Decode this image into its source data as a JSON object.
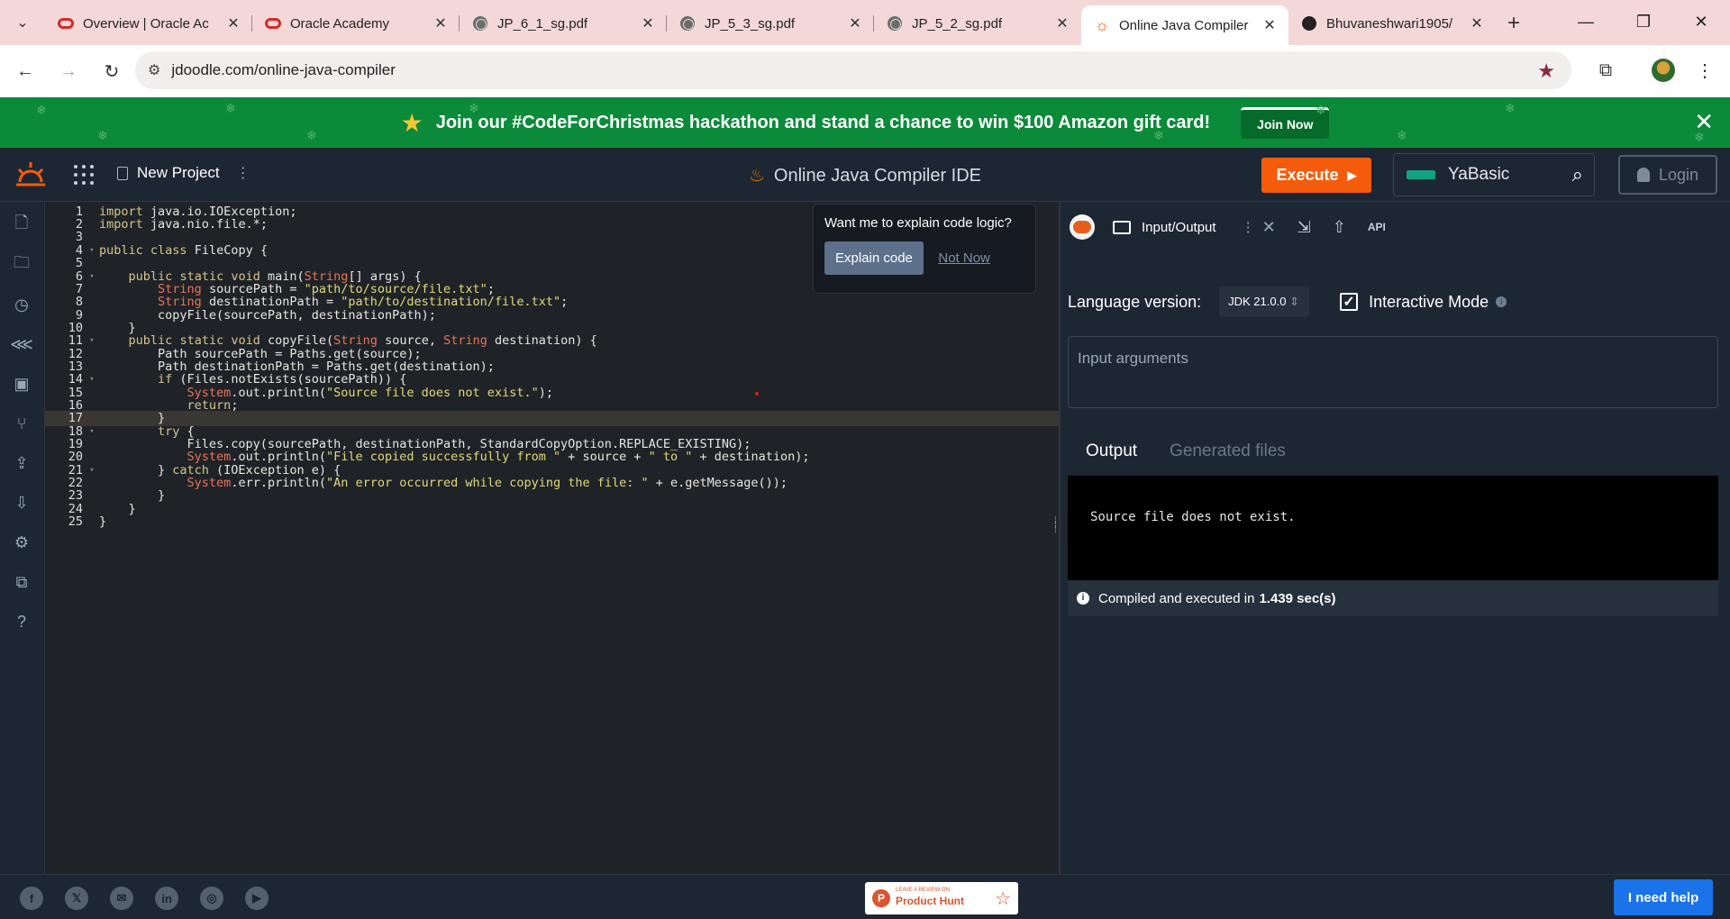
{
  "browser": {
    "tabs": [
      {
        "title": "Overview | Oracle Ac",
        "icon": "oracle-icon"
      },
      {
        "title": "Oracle Academy",
        "icon": "oracle-icon"
      },
      {
        "title": "JP_6_1_sg.pdf",
        "icon": "globe-icon"
      },
      {
        "title": "JP_5_3_sg.pdf",
        "icon": "globe-icon"
      },
      {
        "title": "JP_5_2_sg.pdf",
        "icon": "globe-icon"
      },
      {
        "title": "Online Java Compiler",
        "icon": "jdoodle-icon"
      },
      {
        "title": "Bhuvaneshwari1905/",
        "icon": "github-icon"
      }
    ],
    "url": "jdoodle.com/online-java-compiler"
  },
  "banner": {
    "message": "Join our #CodeForChristmas hackathon and stand a chance to win $100 Amazon gift card!",
    "button": "Join Now"
  },
  "header": {
    "project": "New Project",
    "title": "Online Java Compiler IDE",
    "execute": "Execute",
    "search_text": "YaBasic",
    "login": "Login",
    "accent_color": "#f45b0b"
  },
  "editor": {
    "current_line": 17,
    "lines": [
      "import java.io.IOException;",
      "import java.nio.file.*;",
      "",
      "public class FileCopy {",
      "",
      "    public static void main(String[] args) {",
      "        String sourcePath = \"path/to/source/file.txt\";",
      "        String destinationPath = \"path/to/destination/file.txt\";",
      "        copyFile(sourcePath, destinationPath);",
      "    }",
      "    public static void copyFile(String source, String destination) {",
      "        Path sourcePath = Paths.get(source);",
      "        Path destinationPath = Paths.get(destination);",
      "        if (Files.notExists(sourcePath)) {",
      "            System.out.println(\"Source file does not exist.\");",
      "            return;",
      "        }",
      "        try {",
      "            Files.copy(sourcePath, destinationPath, StandardCopyOption.REPLACE_EXISTING);",
      "            System.out.println(\"File copied successfully from \" + source + \" to \" + destination);",
      "        } catch (IOException e) {",
      "            System.err.println(\"An error occurred while copying the file: \" + e.getMessage());",
      "        }",
      "    }",
      "}"
    ],
    "fold_lines": [
      4,
      6,
      11,
      14,
      18,
      21
    ]
  },
  "explain_popup": {
    "question": "Want me to explain code logic?",
    "explain_button": "Explain code",
    "dismiss_button": "Not Now"
  },
  "right_panel": {
    "tab_label": "Input/Output",
    "api_label": "API",
    "language_label": "Language version:",
    "jdk_version": "JDK 21.0.0",
    "interactive_label": "Interactive Mode",
    "interactive_checked": true,
    "args_placeholder": "Input arguments",
    "output_tab": "Output",
    "files_tab": "Generated files",
    "output_text": "Source file does not exist.",
    "status_prefix": "Compiled and executed in",
    "status_time": "1.439 sec(s)"
  },
  "footer": {
    "social_icons": [
      "facebook-icon",
      "x-icon",
      "mail-icon",
      "linkedin-icon",
      "instagram-icon",
      "youtube-icon"
    ],
    "producthunt_small": "LEAVE A REVIEW ON",
    "producthunt_big": "Product Hunt",
    "help_button": "I need help"
  }
}
